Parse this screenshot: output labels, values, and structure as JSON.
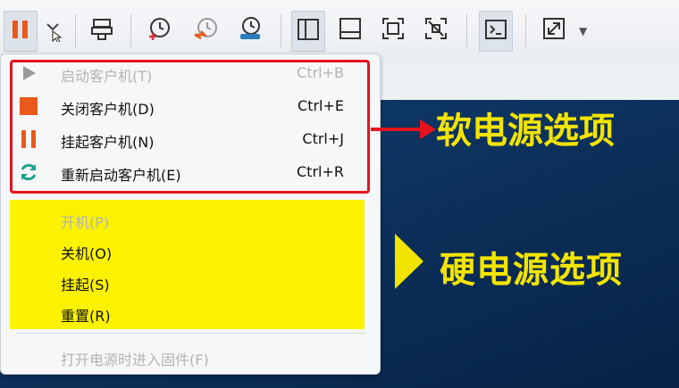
{
  "toolbar": {
    "icons": [
      "pause-icon",
      "dropdown-caret",
      "send-keys-icon",
      "snapshot-take-icon",
      "snapshot-revert-icon",
      "snapshot-manager-icon",
      "view-sidebar-icon",
      "view-console-icon",
      "fullscreen-icon",
      "unity-icon",
      "terminal-icon",
      "stretch-icon"
    ]
  },
  "desktop": {
    "hard_power_label": "硬电源选项",
    "edge_char": "×"
  },
  "annotation": {
    "soft_power_label": "软电源选项"
  },
  "menu": {
    "soft_items": [
      {
        "label": "启动客户机(T)",
        "shortcut": "Ctrl+B",
        "enabled": false,
        "icon": "play-icon"
      },
      {
        "label": "关闭客户机(D)",
        "shortcut": "Ctrl+E",
        "enabled": true,
        "icon": "stop-icon"
      },
      {
        "label": "挂起客户机(N)",
        "shortcut": "Ctrl+J",
        "enabled": true,
        "icon": "pause-icon"
      },
      {
        "label": "重新启动客户机(E)",
        "shortcut": "Ctrl+R",
        "enabled": true,
        "icon": "restart-icon"
      }
    ],
    "hard_items": [
      {
        "label": "开机(P)",
        "enabled": false
      },
      {
        "label": "关机(O)",
        "enabled": true
      },
      {
        "label": "挂起(S)",
        "enabled": true
      },
      {
        "label": "重置(R)",
        "enabled": true
      }
    ],
    "firmware_item": {
      "label": "打开电源时进入固件(F)",
      "enabled": false
    }
  },
  "colors": {
    "accent_red": "#e8121f",
    "highlight_yellow": "#fbf200",
    "label_yellow": "#f3e400",
    "pause_orange": "#e8591b",
    "restart_teal": "#1aa38c"
  }
}
